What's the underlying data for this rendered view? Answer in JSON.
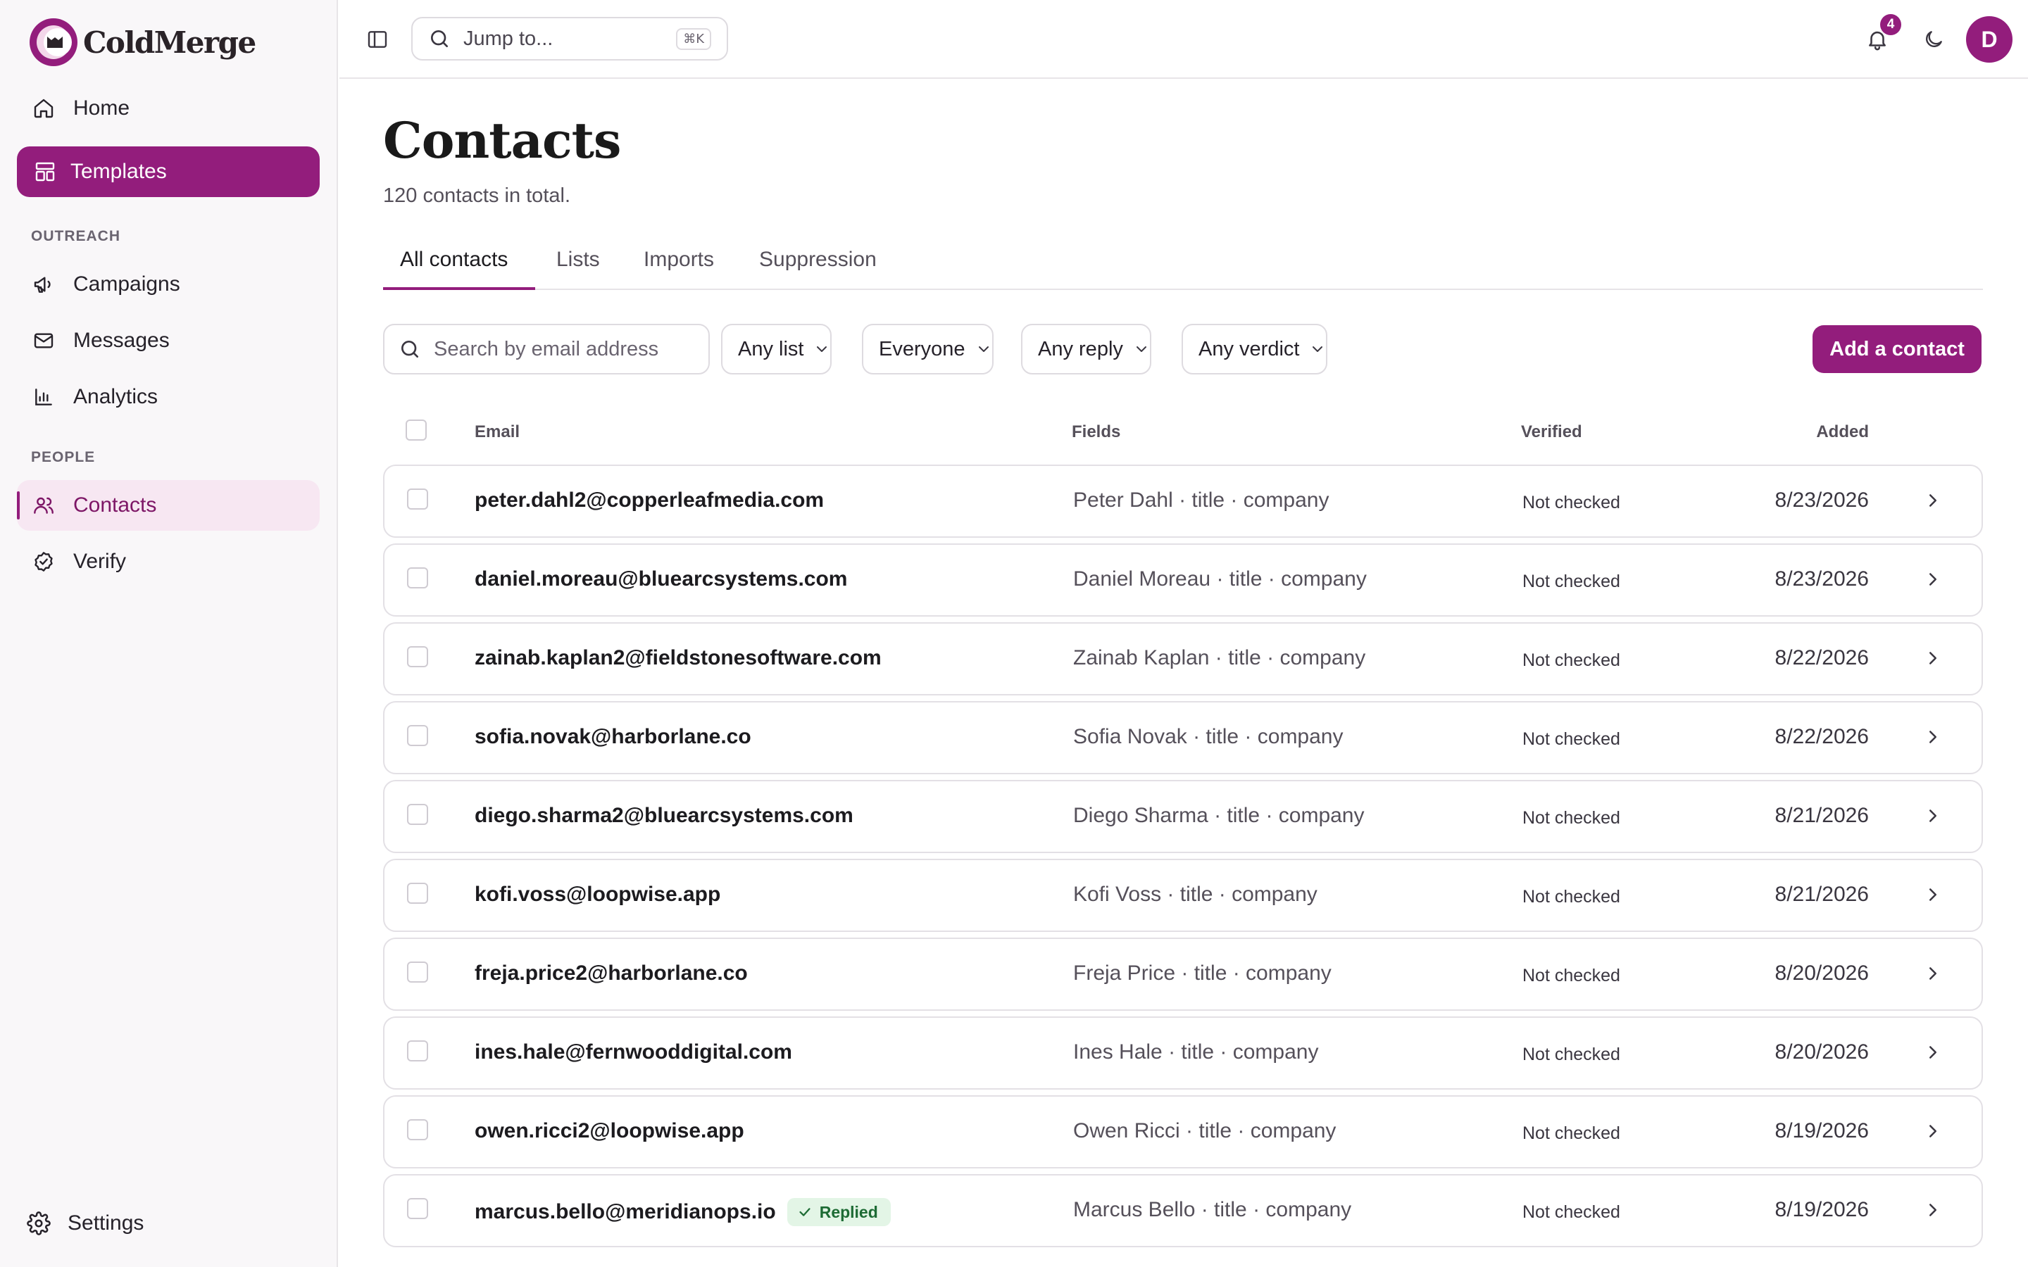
{
  "brand": {
    "name": "ColdMerge"
  },
  "sidebar": {
    "home": "Home",
    "templates": "Templates",
    "outreach_label": "OUTREACH",
    "campaigns": "Campaigns",
    "messages": "Messages",
    "analytics": "Analytics",
    "people_label": "PEOPLE",
    "contacts": "Contacts",
    "verify": "Verify",
    "settings": "Settings"
  },
  "topbar": {
    "search_placeholder": "Jump to...",
    "shortcut": "⌘K",
    "notification_count": "4",
    "avatar_initial": "D"
  },
  "page": {
    "title": "Contacts",
    "subtitle": "120 contacts in total."
  },
  "tabs": [
    "All contacts",
    "Lists",
    "Imports",
    "Suppression"
  ],
  "filters": {
    "search_placeholder": "Search by email address",
    "list": "Any list",
    "audience": "Everyone",
    "reply": "Any reply",
    "verdict": "Any verdict",
    "add_button": "Add a contact"
  },
  "table": {
    "headers": {
      "email": "Email",
      "fields": "Fields",
      "verified": "Verified",
      "added": "Added"
    },
    "rows": [
      {
        "email": "peter.dahl2@copperleafmedia.com",
        "fields": "Peter Dahl · title · company",
        "verified": "Not checked",
        "added": "8/23/2026"
      },
      {
        "email": "daniel.moreau@bluearcsystems.com",
        "fields": "Daniel Moreau · title · company",
        "verified": "Not checked",
        "added": "8/23/2026"
      },
      {
        "email": "zainab.kaplan2@fieldstonesoftware.com",
        "fields": "Zainab Kaplan · title · company",
        "verified": "Not checked",
        "added": "8/22/2026"
      },
      {
        "email": "sofia.novak@harborlane.co",
        "fields": "Sofia Novak · title · company",
        "verified": "Not checked",
        "added": "8/22/2026"
      },
      {
        "email": "diego.sharma2@bluearcsystems.com",
        "fields": "Diego Sharma · title · company",
        "verified": "Not checked",
        "added": "8/21/2026"
      },
      {
        "email": "kofi.voss@loopwise.app",
        "fields": "Kofi Voss · title · company",
        "verified": "Not checked",
        "added": "8/21/2026"
      },
      {
        "email": "freja.price2@harborlane.co",
        "fields": "Freja Price · title · company",
        "verified": "Not checked",
        "added": "8/20/2026"
      },
      {
        "email": "ines.hale@fernwooddigital.com",
        "fields": "Ines Hale · title · company",
        "verified": "Not checked",
        "added": "8/20/2026"
      },
      {
        "email": "owen.ricci2@loopwise.app",
        "fields": "Owen Ricci · title · company",
        "verified": "Not checked",
        "added": "8/19/2026"
      },
      {
        "email": "marcus.bello@meridianops.io",
        "fields": "Marcus Bello · title · company",
        "verified": "Not checked",
        "added": "8/19/2026",
        "badge": "Replied"
      }
    ]
  },
  "colors": {
    "accent": "#931d7c",
    "accent_soft": "#f7e7f2",
    "replied_bg": "#e3f5e6",
    "replied_text": "#1d6b34"
  }
}
